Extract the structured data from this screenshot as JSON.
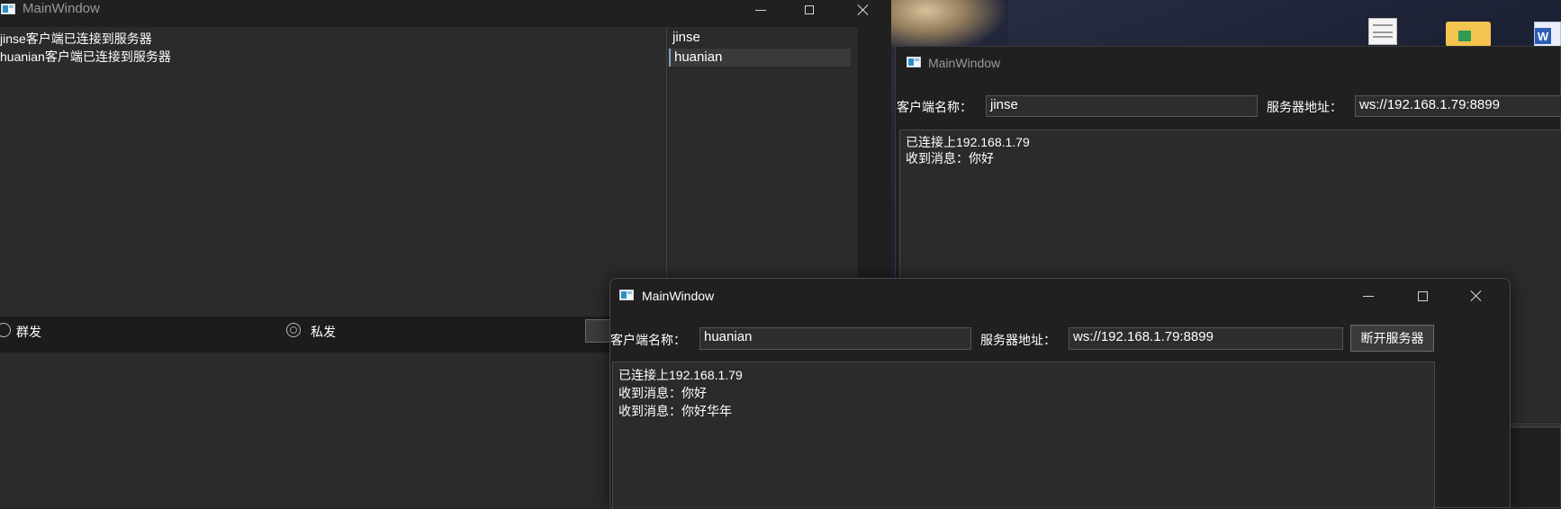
{
  "server_window": {
    "title": "MainWindow",
    "log": [
      "jinse客户端已连接到服务器",
      "huanian客户端已连接到服务器"
    ],
    "clients": [
      "jinse",
      "huanian"
    ],
    "radio_group": "群发",
    "radio_private": "私发"
  },
  "client_jinse": {
    "title": "MainWindow",
    "name_label": "客户端名称：",
    "name_value": "jinse",
    "server_label": "服务器地址：",
    "server_value": "ws://192.168.1.79:8899",
    "messages": [
      "已连接上192.168.1.79",
      "收到消息：你好"
    ]
  },
  "client_huanian": {
    "title": "MainWindow",
    "name_label": "客户端名称：",
    "name_value": "huanian",
    "server_label": "服务器地址：",
    "server_value": "ws://192.168.1.79:8899",
    "disconnect_label": "断开服务器",
    "messages": [
      "已连接上192.168.1.79",
      "收到消息：你好",
      "收到消息：你好华年"
    ]
  },
  "colors": {
    "window_bg": "#202020",
    "panel_bg": "#2b2b2b",
    "selected_item": "#3a3a3a",
    "text": "#ffffff"
  },
  "icons": [
    "app-icon",
    "minimize-icon",
    "maximize-icon",
    "close-icon",
    "text-file-icon",
    "folder-icon",
    "word-file-icon"
  ]
}
